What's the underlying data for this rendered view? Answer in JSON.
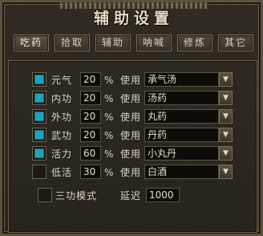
{
  "window": {
    "title": "辅助设置"
  },
  "tabs": [
    {
      "label": "吃药"
    },
    {
      "label": "拾取"
    },
    {
      "label": "辅助"
    },
    {
      "label": "呐喊"
    },
    {
      "label": "修炼"
    },
    {
      "label": "其它"
    }
  ],
  "units": {
    "percent": "%",
    "use": "使用"
  },
  "rows": [
    {
      "label": "元气",
      "checked": true,
      "percent": "20",
      "item": "承气汤"
    },
    {
      "label": "内功",
      "checked": true,
      "percent": "20",
      "item": "汤药"
    },
    {
      "label": "外功",
      "checked": true,
      "percent": "20",
      "item": "丸药"
    },
    {
      "label": "武功",
      "checked": true,
      "percent": "20",
      "item": "丹药"
    },
    {
      "label": "活力",
      "checked": true,
      "percent": "60",
      "item": "小丸丹"
    },
    {
      "label": "低活",
      "checked": false,
      "percent": "30",
      "item": "白酒"
    }
  ],
  "mode": {
    "label": "三功模式",
    "checked": false,
    "delay_label": "延迟",
    "delay_value": "1000"
  },
  "colors": {
    "accent": "#1fa3bd"
  }
}
